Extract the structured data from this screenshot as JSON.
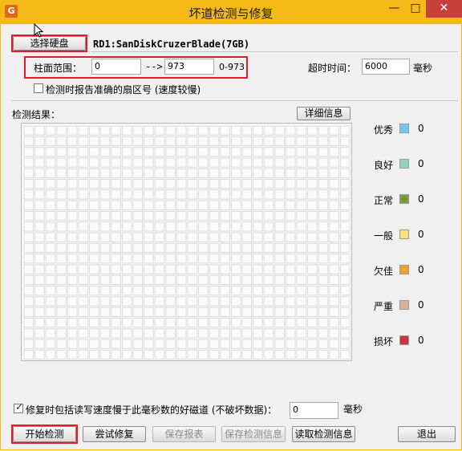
{
  "window": {
    "title": "坏道检测与修复",
    "icon": "app-icon",
    "min_glyph": "—",
    "max_glyph": "□",
    "close_glyph": "✕"
  },
  "drive": {
    "select_button": "选择硬盘",
    "name": "RD1:SanDiskCruzerBlade(7GB)"
  },
  "range": {
    "label": "柱面范围：",
    "start": "0",
    "arrow": "-->",
    "end": "973",
    "hint": "0-973"
  },
  "timeout": {
    "label": "超时时间：",
    "value": "6000",
    "unit": "毫秒"
  },
  "accurate_report": {
    "label": "检测时报告准确的扇区号 (速度较慢)",
    "checked": false
  },
  "results": {
    "label": "检测结果：",
    "details_button": "详细信息"
  },
  "legend": [
    {
      "label": "优秀",
      "color": "#74c8f0",
      "count": "0"
    },
    {
      "label": "良好",
      "color": "#8fd6b9",
      "count": "0"
    },
    {
      "label": "正常",
      "color": "#7c9c3a",
      "count": "0"
    },
    {
      "label": "一般",
      "color": "#f7e27a",
      "count": "0"
    },
    {
      "label": "欠佳",
      "color": "#f0a12a",
      "count": "0"
    },
    {
      "label": "严重",
      "color": "#d8b49a",
      "count": "0"
    },
    {
      "label": "损坏",
      "color": "#c8333a",
      "count": "0"
    }
  ],
  "repair_option": {
    "label": "修复时包括读写速度慢于此毫秒数的好磁道 (不破坏数据)：",
    "checked": true,
    "value": "0",
    "unit": "毫秒"
  },
  "actions": {
    "start": "开始检测",
    "try_repair": "尝试修复",
    "save_report": "保存报表",
    "save_result": "保存检测信息",
    "load_result": "读取检测信息",
    "exit": "退出"
  }
}
